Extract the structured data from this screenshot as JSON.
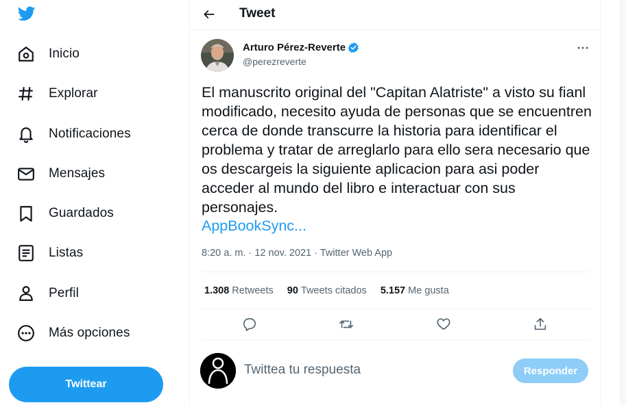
{
  "nav": {
    "items": [
      {
        "label": "Inicio",
        "icon": "home-icon"
      },
      {
        "label": "Explorar",
        "icon": "hashtag-icon"
      },
      {
        "label": "Notificaciones",
        "icon": "bell-icon"
      },
      {
        "label": "Mensajes",
        "icon": "envelope-icon"
      },
      {
        "label": "Guardados",
        "icon": "bookmark-icon"
      },
      {
        "label": "Listas",
        "icon": "list-icon"
      },
      {
        "label": "Perfil",
        "icon": "person-icon"
      },
      {
        "label": "Más opciones",
        "icon": "more-circle-icon"
      }
    ],
    "tweet_button": "Twittear"
  },
  "header": {
    "title": "Tweet"
  },
  "tweet": {
    "author_name": "Arturo Pérez-Reverte",
    "author_handle": "@perezreverte",
    "text": "El manuscrito original del \"Capitan Alatriste\" a visto su fianl modificado, necesito ayuda de personas que se encuentren cerca de donde transcurre la historia para identificar el problema y tratar de arreglarlo para ello sera necesario que os descargeis la siguiente aplicacion para asi poder acceder al mundo del libro e interactuar con sus personajes.",
    "link": "AppBookSync...",
    "meta": "8:20 a. m. · 12 nov. 2021 · Twitter Web App",
    "stats": [
      {
        "num": "1.308",
        "label": "Retweets"
      },
      {
        "num": "90",
        "label": "Tweets citados"
      },
      {
        "num": "5.157",
        "label": "Me gusta"
      }
    ]
  },
  "reply": {
    "placeholder": "Twittea tu respuesta",
    "button": "Responder"
  },
  "colors": {
    "accent": "#1d9bf0",
    "text": "#0f1419",
    "muted": "#536471"
  }
}
